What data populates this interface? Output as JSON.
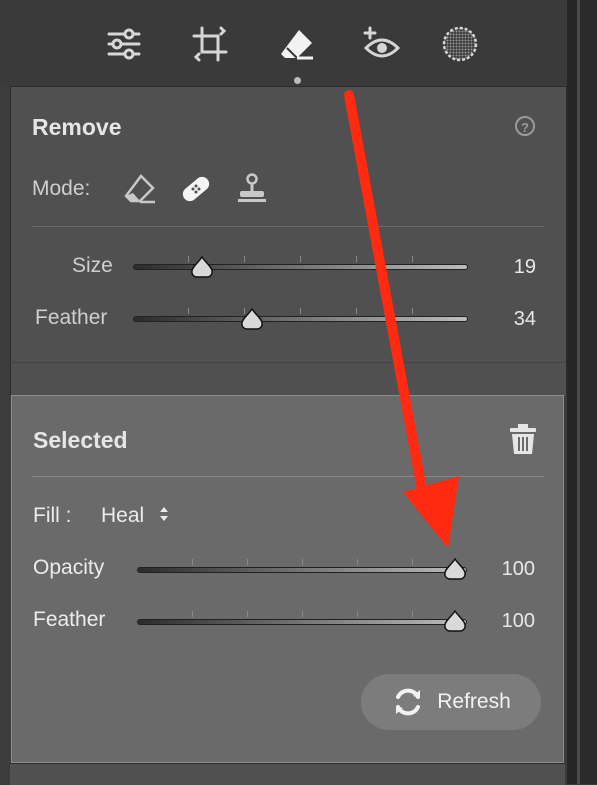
{
  "toolbar": {
    "tools": [
      {
        "name": "edit-sliders-icon"
      },
      {
        "name": "crop-icon"
      },
      {
        "name": "eraser-icon",
        "active": true
      },
      {
        "name": "red-eye-icon"
      },
      {
        "name": "masking-icon"
      }
    ]
  },
  "remove": {
    "title": "Remove",
    "help_symbol": "?",
    "mode_label": "Mode:",
    "modes": [
      "eraser-mode-icon",
      "heal-bandage-icon",
      "clone-stamp-icon"
    ],
    "sliders": [
      {
        "label": "Size",
        "value": "19",
        "position": 0.21
      },
      {
        "label": "Feather",
        "value": "34",
        "position": 0.35
      }
    ]
  },
  "selected": {
    "title": "Selected",
    "fill_label": "Fill :",
    "fill_value": "Heal",
    "sliders": [
      {
        "label": "Opacity",
        "value": "100",
        "position": 1.0
      },
      {
        "label": "Feather",
        "value": "100",
        "position": 1.0
      }
    ],
    "refresh_label": "Refresh"
  },
  "colors": {
    "annotation_arrow": "#ff2a10",
    "selected_panel": "#6a6a6a",
    "remove_panel": "#505050"
  }
}
